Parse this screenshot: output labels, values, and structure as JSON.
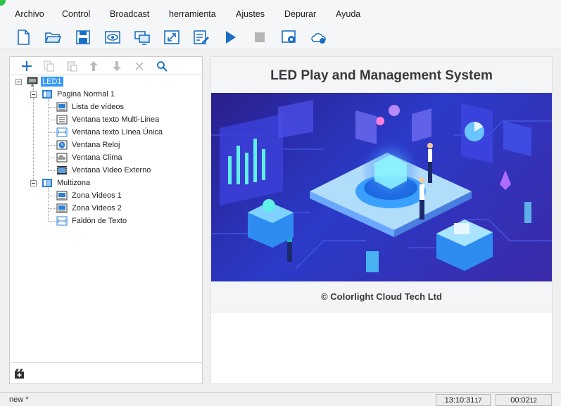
{
  "menu": {
    "items": [
      "Archivo",
      "Control",
      "Broadcast",
      "herramienta",
      "Ajustes",
      "Depurar",
      "Ayuda"
    ]
  },
  "toolbar": {
    "icons": [
      "new-file-icon",
      "open-folder-icon",
      "save-icon",
      "preview-eye-icon",
      "screen-settings-icon",
      "fullscreen-icon",
      "edit-icon",
      "play-icon",
      "stop-icon",
      "settings-gear-icon",
      "cloud-icon"
    ]
  },
  "tree_toolbar": {
    "icons": [
      "add-icon",
      "copy-icon",
      "paste-icon",
      "move-up-icon",
      "move-down-icon",
      "delete-icon",
      "search-icon"
    ]
  },
  "tree": {
    "root": "LED1",
    "pages": [
      {
        "label": "Pagina Normal 1",
        "children": [
          "Lista de vídeos",
          "Ventana  texto Multi-Linea",
          "Ventana texto Línea Única",
          "Ventana Reloj",
          "Ventana  Clima",
          "Ventana  Video Externo"
        ]
      },
      {
        "label": "Multizona",
        "children": [
          "Zona Videos 1",
          "Zona Videos 2",
          "Faldón de Texto"
        ]
      }
    ]
  },
  "welcome": {
    "title": "LED Play and Management System",
    "copyright": "© Colorlight Cloud Tech Ltd"
  },
  "status": {
    "document": "new *",
    "clock_main": "13:10:31",
    "clock_sub": "17",
    "timer_main": "00:02",
    "timer_sub": "12"
  },
  "colors": {
    "accent": "#3399ff",
    "toolbar_icon": "#1a6fc4",
    "banner_dark": "#2a1f8c",
    "banner_light": "#2b3ac8"
  }
}
